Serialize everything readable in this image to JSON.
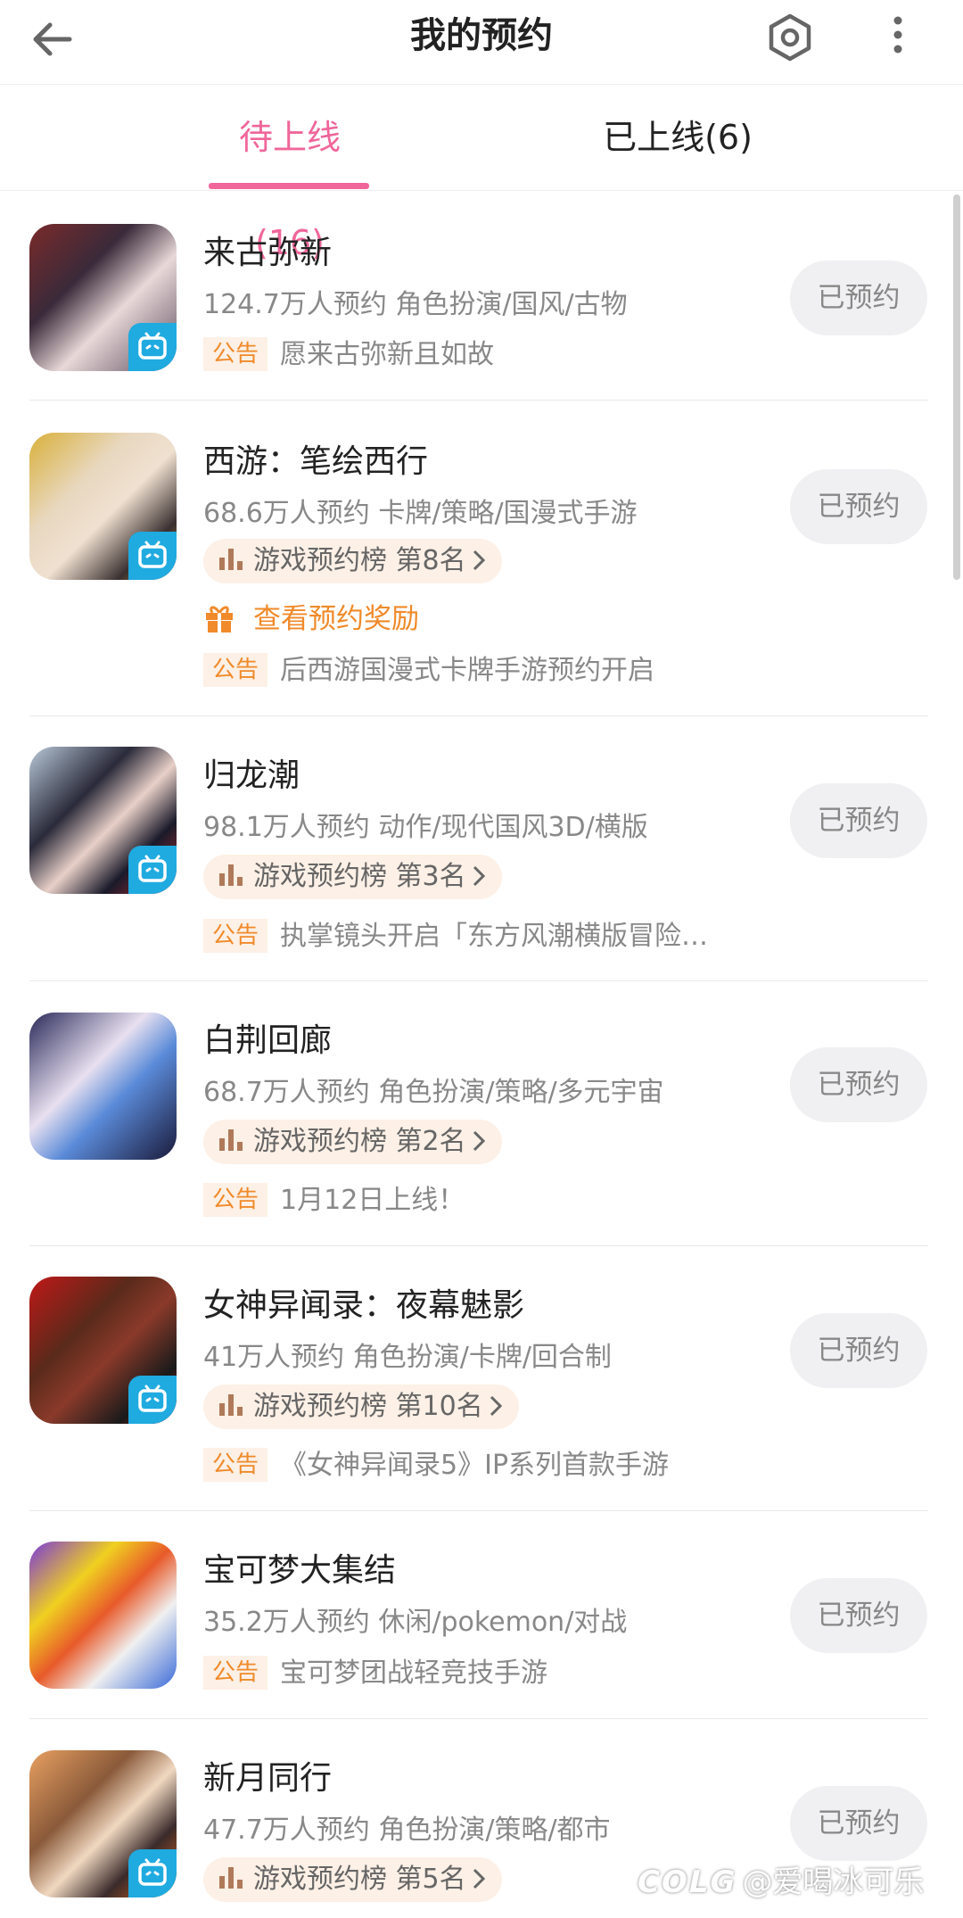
{
  "header": {
    "title": "我的预约",
    "back_icon": "back-arrow-icon",
    "settings_icon": "settings-icon",
    "more_icon": "more-vertical-icon"
  },
  "tabs": [
    {
      "label": "待上线(16)",
      "active": true
    },
    {
      "label": "已上线(6)",
      "active": false
    }
  ],
  "colors": {
    "accent": "#f0669a",
    "orange": "#f08a2a",
    "bilibili": "#1faae0"
  },
  "games": [
    {
      "name": "来古弥新",
      "meta": "124.7万人预约 角色扮演/国风/古物",
      "notice_tag": "公告",
      "notice": "愿来古弥新且如故",
      "button": "已预约"
    },
    {
      "name": "西游：笔绘西行",
      "meta": "68.6万人预约 卡牌/策略/国漫式手游",
      "rank": "游戏预约榜 第8名",
      "reward": "查看预约奖励",
      "notice_tag": "公告",
      "notice": "后西游国漫式卡牌手游预约开启",
      "button": "已预约"
    },
    {
      "name": "归龙潮",
      "meta": "98.1万人预约 动作/现代国风3D/横版",
      "rank": "游戏预约榜 第3名",
      "notice_tag": "公告",
      "notice": "执掌镜头开启「东方风潮横版冒险…",
      "button": "已预约"
    },
    {
      "name": "白荆回廊",
      "meta": "68.7万人预约 角色扮演/策略/多元宇宙",
      "rank": "游戏预约榜 第2名",
      "notice_tag": "公告",
      "notice": "1月12日上线！",
      "button": "已预约"
    },
    {
      "name": "女神异闻录：夜幕魅影",
      "meta": "41万人预约 角色扮演/卡牌/回合制",
      "rank": "游戏预约榜 第10名",
      "notice_tag": "公告",
      "notice": "《女神异闻录5》IP系列首款手游",
      "button": "已预约"
    },
    {
      "name": "宝可梦大集结",
      "meta": "35.2万人预约 休闲/pokemon/对战",
      "notice_tag": "公告",
      "notice": "宝可梦团战轻竞技手游",
      "button": "已预约"
    },
    {
      "name": "新月同行",
      "meta": "47.7万人预约 角色扮演/策略/都市",
      "rank": "游戏预约榜 第5名",
      "button": "已预约"
    }
  ],
  "watermark": {
    "logo": "COLG",
    "handle": "@爱喝冰可乐"
  }
}
